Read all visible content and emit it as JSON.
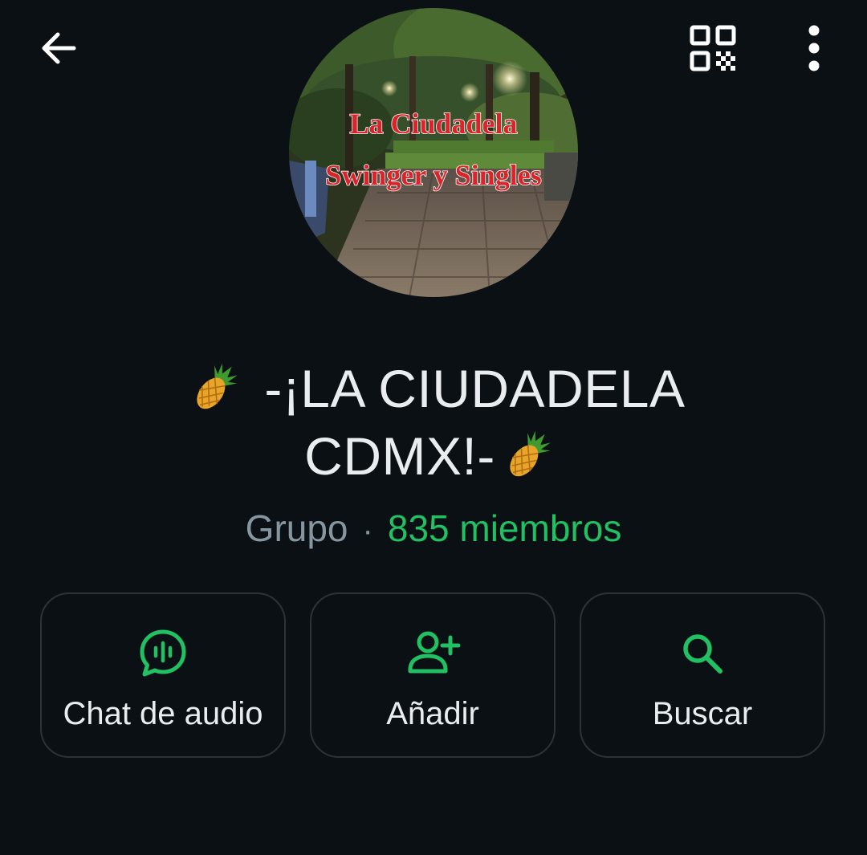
{
  "header": {
    "back_icon": "arrow-left-icon",
    "qr_icon": "qr-code-icon",
    "menu_icon": "more-vertical-icon"
  },
  "avatar": {
    "caption_line1": "La Ciudadela",
    "caption_line2": "Swinger y Singles"
  },
  "group": {
    "name_line1": "-¡LA CIUDADELA",
    "name_line2": "CDMX!-",
    "emoji": "pineapple",
    "kind": "Grupo",
    "separator": "·",
    "members": "835 miembros"
  },
  "actions": [
    {
      "label": "Chat de audio",
      "icon": "audio-chat-icon"
    },
    {
      "label": "Añadir",
      "icon": "add-person-icon"
    },
    {
      "label": "Buscar",
      "icon": "search-icon"
    }
  ],
  "colors": {
    "background": "#0b1014",
    "accent": "#21c063",
    "text": "#e9edef",
    "secondary_text": "#8696a0",
    "card_border": "#2a3338"
  }
}
